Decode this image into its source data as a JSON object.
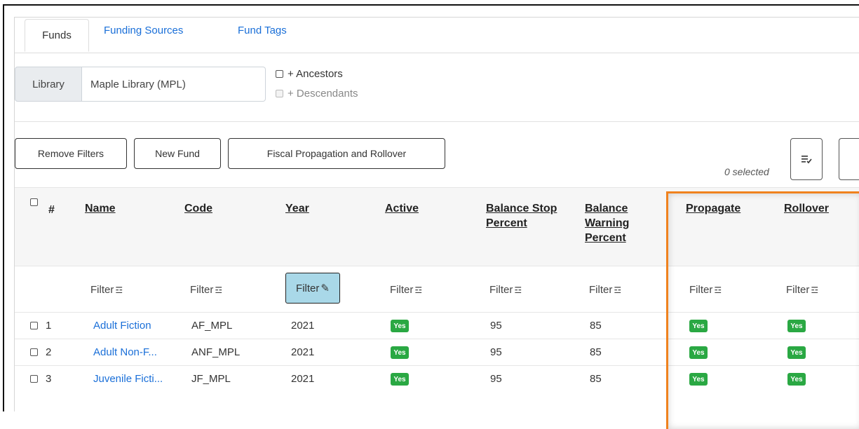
{
  "tabs": {
    "funds": "Funds",
    "funding_sources": "Funding Sources",
    "fund_tags": "Fund Tags"
  },
  "library": {
    "addon_label": "Library",
    "value": "Maple Library (MPL)",
    "ancestors_label": "+ Ancestors",
    "descendants_label": "+ Descendants"
  },
  "toolbar": {
    "remove_filters": "Remove Filters",
    "new_fund": "New Fund",
    "fiscal": "Fiscal Propagation and Rollover",
    "selected": "0 selected"
  },
  "columns": {
    "hash": "#",
    "name": "Name",
    "code": "Code",
    "year": "Year",
    "active": "Active",
    "stop1": "Balance Stop",
    "stop2": "Percent",
    "warn1": "Balance",
    "warn2": "Warning",
    "warn3": "Percent",
    "propagate": "Propagate",
    "rollover": "Rollover"
  },
  "filter_label": "Filter",
  "rows": [
    {
      "num": "1",
      "name": "Adult Fiction",
      "code": "AF_MPL",
      "year": "2021",
      "active": "Yes",
      "stop": "95",
      "warn": "85",
      "propagate": "Yes",
      "rollover": "Yes"
    },
    {
      "num": "2",
      "name": "Adult Non-F...",
      "code": "ANF_MPL",
      "year": "2021",
      "active": "Yes",
      "stop": "95",
      "warn": "85",
      "propagate": "Yes",
      "rollover": "Yes"
    },
    {
      "num": "3",
      "name": "Juvenile Ficti...",
      "code": "JF_MPL",
      "year": "2021",
      "active": "Yes",
      "stop": "95",
      "warn": "85",
      "propagate": "Yes",
      "rollover": "Yes"
    }
  ],
  "colors": {
    "accent_link": "#1a6fd8",
    "yes_badge": "#2aa843",
    "highlight": "#f0821e",
    "filter_active": "#a9d8e8"
  }
}
